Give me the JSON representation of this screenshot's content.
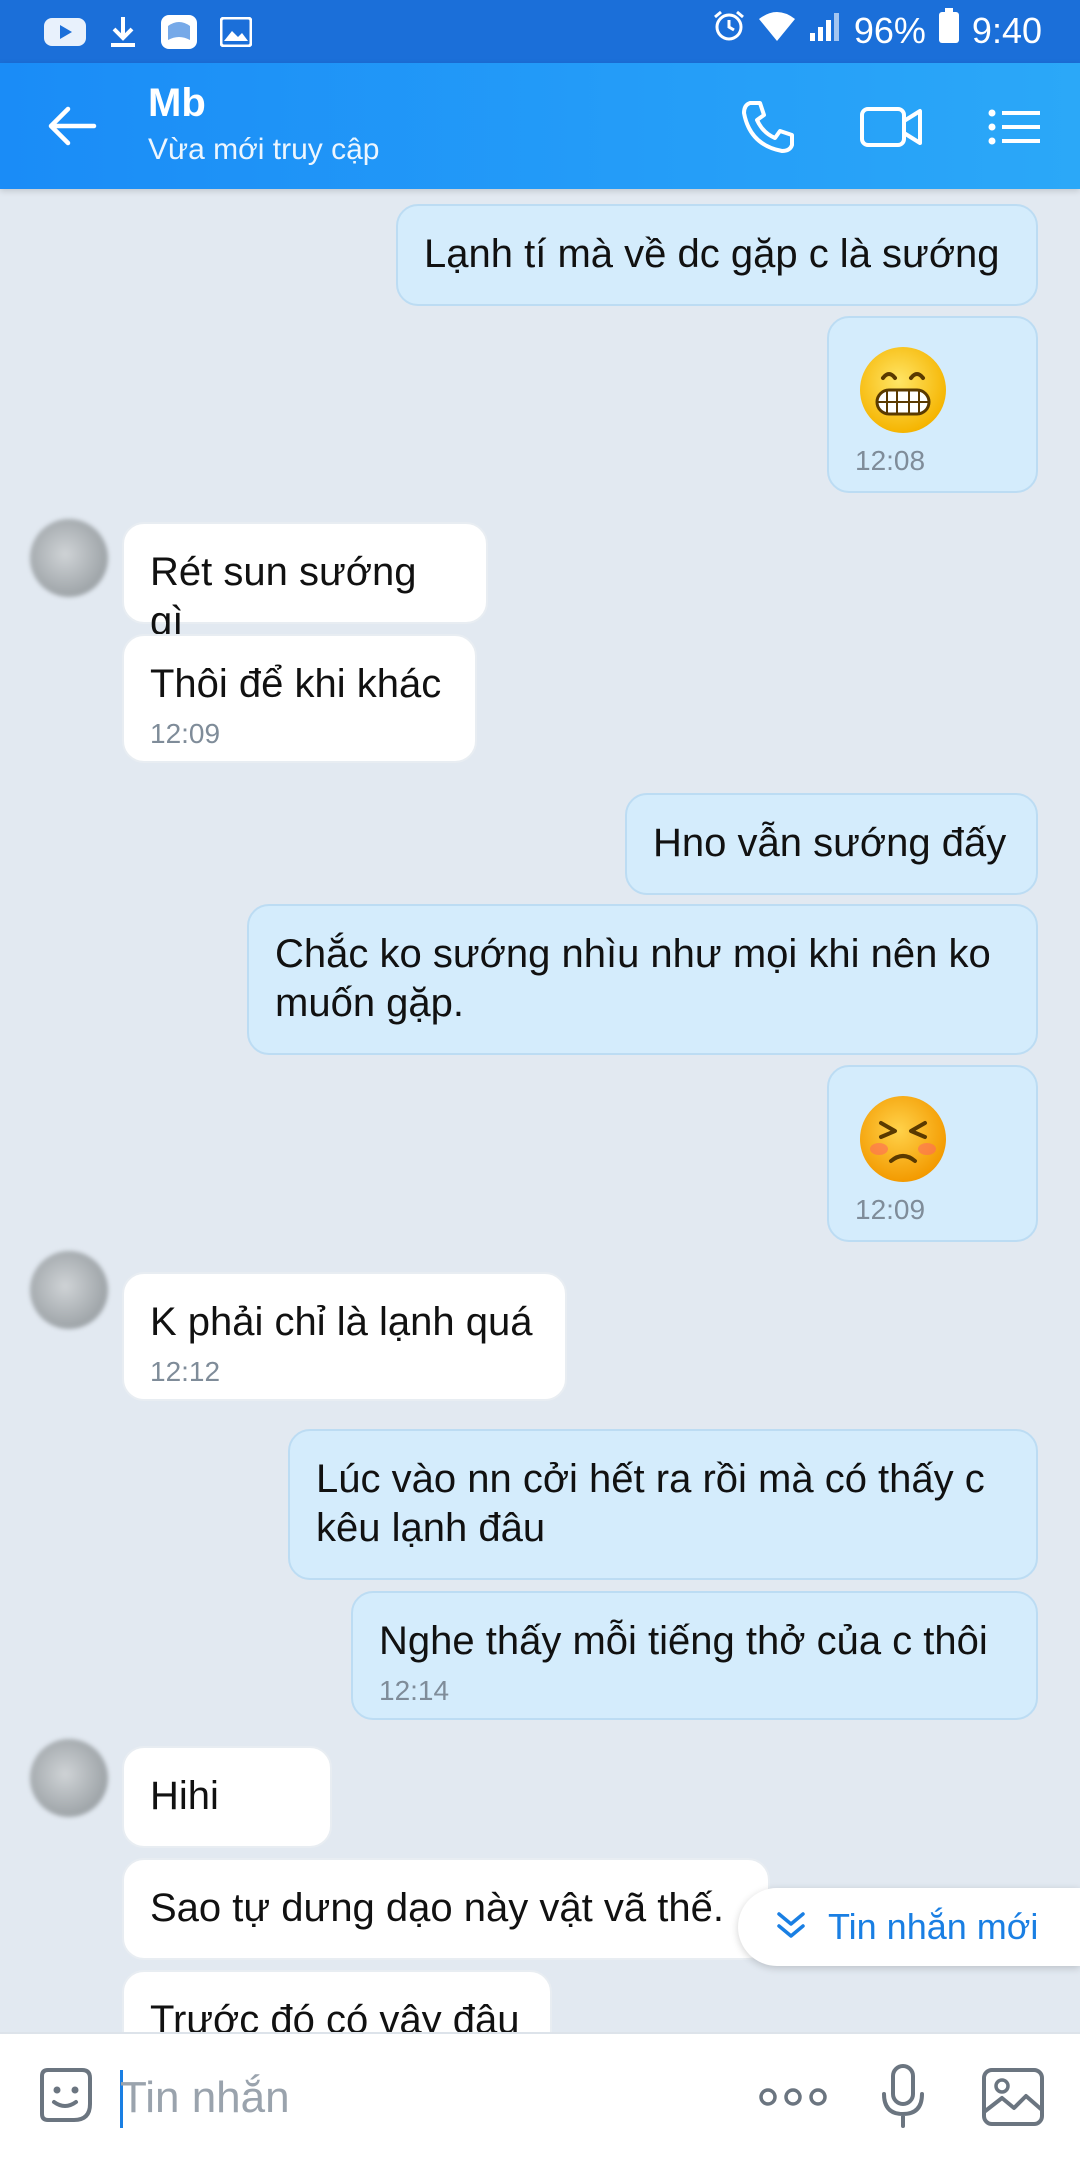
{
  "status_bar": {
    "battery": "96%",
    "time": "9:40"
  },
  "header": {
    "contact_name": "Mb",
    "contact_status": "Vừa mới truy cập"
  },
  "messages": [
    {
      "dir": "out",
      "text": "Lạnh tí mà về dc gặp c là sướng",
      "time": ""
    },
    {
      "dir": "out",
      "emoji": "grinning-face",
      "time": "12:08"
    },
    {
      "dir": "in",
      "text": "Rét sun sướng gì",
      "time": ""
    },
    {
      "dir": "in",
      "text": "Thôi để khi khác",
      "time": "12:09"
    },
    {
      "dir": "out",
      "text": "Hno vẫn sướng đấy",
      "time": ""
    },
    {
      "dir": "out",
      "text": "Chắc ko sướng nhìu như mọi khi nên ko muốn gặp.",
      "time": ""
    },
    {
      "dir": "out",
      "emoji": "annoyed-face",
      "time": "12:09"
    },
    {
      "dir": "in",
      "text": "K phải chỉ là lạnh quá",
      "time": "12:12"
    },
    {
      "dir": "out",
      "text": "Lúc vào nn cởi hết ra rồi mà có thấy c kêu lạnh đâu",
      "time": ""
    },
    {
      "dir": "out",
      "text": "Nghe thấy mỗi tiếng thở của c thôi",
      "time": "12:14"
    },
    {
      "dir": "in",
      "text": "Hihi",
      "time": ""
    },
    {
      "dir": "in",
      "text": "Sao tự dưng dạo này vật vã thế.",
      "time": ""
    },
    {
      "dir": "in",
      "text": "Trước đó có vậy đâu",
      "time": ""
    }
  ],
  "new_message_pill": {
    "label": "Tin nhắn mới"
  },
  "input_bar": {
    "placeholder": "Tin nhắn"
  },
  "colors": {
    "header": "#1a8cf7",
    "status_bar": "#1b6fd9",
    "outgoing_bubble": "#d4ecfc",
    "incoming_bubble": "#ffffff",
    "chat_background": "#e2e9f1",
    "accent": "#1a7fe3"
  }
}
